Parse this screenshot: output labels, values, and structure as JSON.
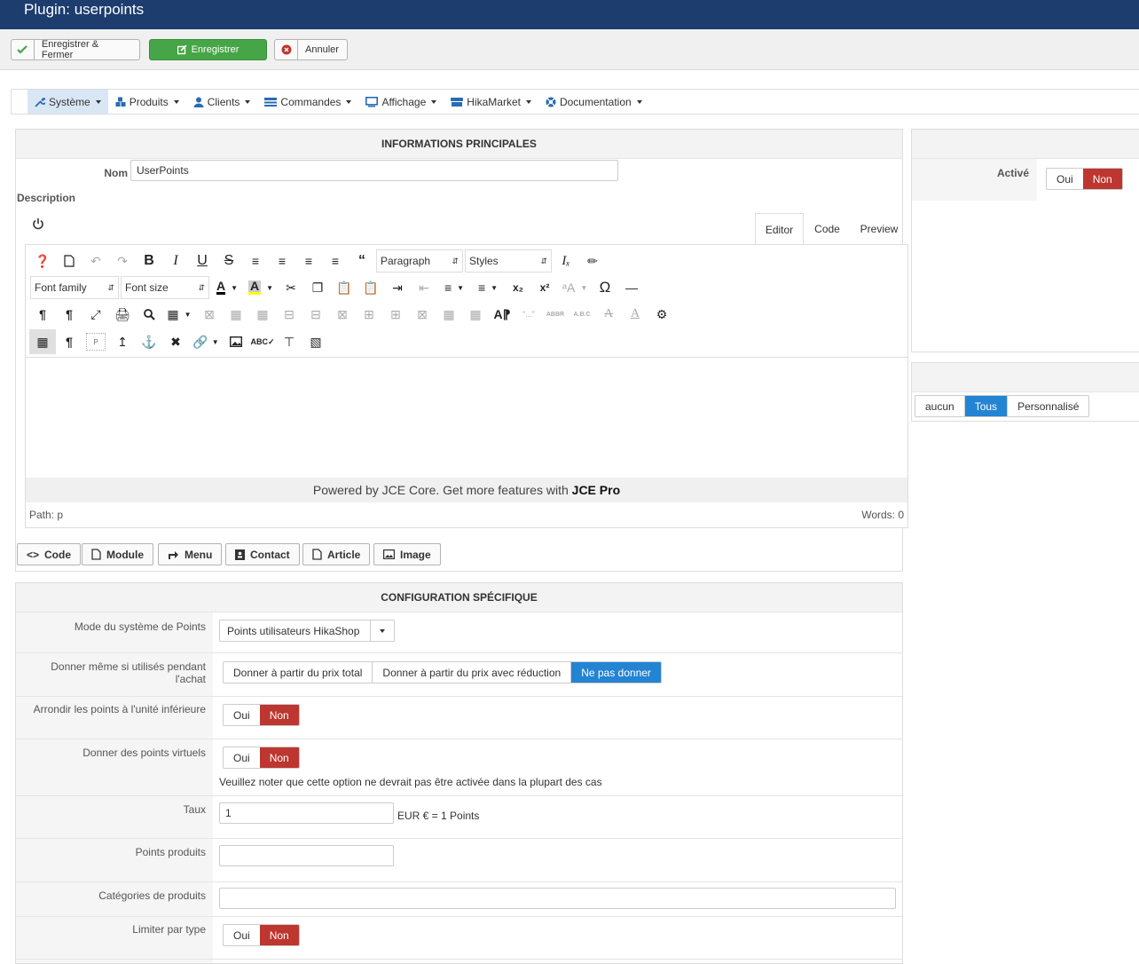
{
  "app": {
    "title": "Plugin: userpoints"
  },
  "toolbar": {
    "save_close_label": "Enregistrer & Fermer",
    "save_label": "Enregistrer",
    "cancel_label": "Annuler"
  },
  "menu": {
    "items": [
      {
        "label": "Système",
        "icon": "wrench-icon"
      },
      {
        "label": "Produits",
        "icon": "cubes-icon"
      },
      {
        "label": "Clients",
        "icon": "user-icon"
      },
      {
        "label": "Commandes",
        "icon": "list-icon"
      },
      {
        "label": "Affichage",
        "icon": "monitor-icon"
      },
      {
        "label": "HikaMarket",
        "icon": "store-icon"
      },
      {
        "label": "Documentation",
        "icon": "lifebuoy-icon"
      }
    ]
  },
  "main_info": {
    "title": "INFORMATIONS PRINCIPALES",
    "name_label": "Nom",
    "name_value": "UserPoints",
    "description_label": "Description"
  },
  "editor": {
    "tabs": [
      "Editor",
      "Code",
      "Preview"
    ],
    "format_select": "Paragraph",
    "styles_select": "Styles",
    "font_family_select": "Font family",
    "font_size_select": "Font size",
    "footer_text": "Powered by JCE Core. Get more features with ",
    "footer_brand": "JCE Pro",
    "path_label": "Path:",
    "path_value": "p",
    "words_label": "Words: 0"
  },
  "editor_buttons": [
    "Code",
    "Module",
    "Menu",
    "Contact",
    "Article",
    "Image"
  ],
  "right_panel": {
    "active_label": "Activé",
    "yes": "Oui",
    "no": "Non",
    "access_options": [
      "aucun",
      "Tous",
      "Personnalisé"
    ]
  },
  "specific": {
    "title": "CONFIGURATION SPÉCIFIQUE",
    "mode_label": "Mode du système de Points",
    "mode_value": "Points utilisateurs HikaShop",
    "give_used_label": "Donner même si utilisés pendant l'achat",
    "give_options": [
      "Donner à partir du prix total",
      "Donner à partir du prix avec réduction",
      "Ne pas donner"
    ],
    "round_label": "Arrondir les points à l'unité inférieure",
    "virtual_label": "Donner des points virtuels",
    "virtual_note": "Veuillez noter que cette option ne devrait pas être activée dans la plupart des cas",
    "rate_label": "Taux",
    "rate_value": "1",
    "rate_suffix": "EUR € = 1 Points",
    "product_points_label": "Points produits",
    "product_points_value": "",
    "categories_label": "Catégories de produits",
    "categories_value": "",
    "limit_type_label": "Limiter par type",
    "yes": "Oui",
    "no": "Non"
  }
}
